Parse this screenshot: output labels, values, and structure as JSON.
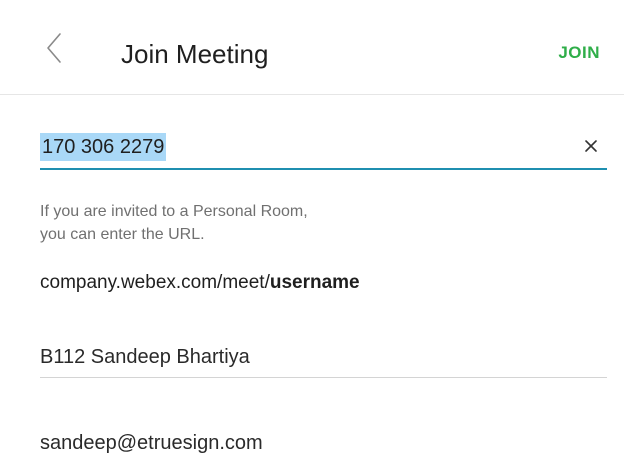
{
  "header": {
    "title": "Join Meeting",
    "join_label": "JOIN"
  },
  "meeting_number": {
    "value": "170 306 2279"
  },
  "hint": {
    "line1": "If you are invited to a Personal Room,",
    "line2": "you can enter the URL."
  },
  "url_example": {
    "prefix": "company.webex.com/meet/",
    "bold": "username"
  },
  "name_field": {
    "value": "B112 Sandeep Bhartiya"
  },
  "email_field": {
    "value": "sandeep@etruesign.com"
  },
  "icons": {
    "back": "chevron-left-icon",
    "clear": "close-icon"
  },
  "colors": {
    "join": "#2fae49",
    "focus_underline": "#1f8fb0",
    "selection": "#a9d8f7",
    "hint": "#707070"
  }
}
